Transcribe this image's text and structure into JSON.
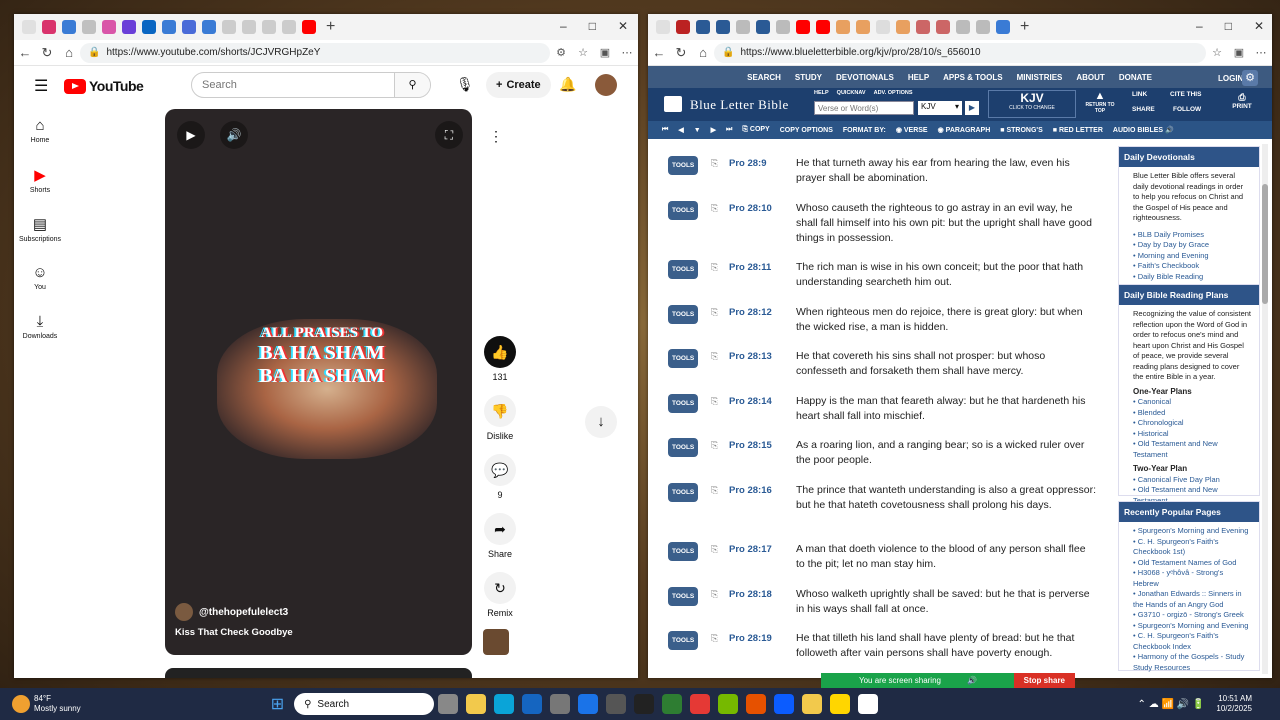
{
  "colors": {
    "yt_red": "#ff0000",
    "blb_nav": "#3d5a80",
    "blb_bar": "#1d3f6e",
    "blb_tool": "#2b5486",
    "blb_link": "#2a5a95"
  },
  "left": {
    "url": "https://www.youtube.com/shorts/JCJVRGHpZeY",
    "logo": "YouTube",
    "search_placeholder": "Search",
    "create_label": "Create",
    "sidebar": [
      {
        "label": "Home",
        "icon": "home-icon"
      },
      {
        "label": "Shorts",
        "icon": "shorts-icon"
      },
      {
        "label": "Subscriptions",
        "icon": "subscriptions-icon"
      },
      {
        "label": "You",
        "icon": "user-icon"
      },
      {
        "label": "Downloads",
        "icon": "download-icon"
      }
    ],
    "art_lines": [
      "ALL PRAISES TO",
      "BA HA SHAM",
      "BA HA SHAM"
    ],
    "channel": "@thehopefulelect3",
    "song": "Kiss That Check Goodbye",
    "likes": "131",
    "dislike": "Dislike",
    "comments": "9",
    "share": "Share",
    "remix": "Remix"
  },
  "right": {
    "url": "https://www.blueletterbible.org/kjv/pro/28/10/s_656010",
    "nav": [
      "SEARCH",
      "STUDY",
      "DEVOTIONALS",
      "HELP",
      "APPS & TOOLS",
      "MINISTRIES",
      "ABOUT",
      "DONATE"
    ],
    "login": "LOGIN",
    "brand": "Blue Letter Bible",
    "sublinks": [
      "HELP",
      "QUICKNAV",
      "ADV. OPTIONS"
    ],
    "search_placeholder": "Verse or Word(s)",
    "version": "KJV",
    "version_big": "KJV",
    "version_sub": "CLICK TO CHANGE",
    "return_top": "RETURN TO TOP",
    "link": "LINK",
    "cite": "CITE THIS",
    "share": "SHARE",
    "follow": "FOLLOW",
    "print": "PRINT",
    "toolbar": [
      "COPY",
      "COPY OPTIONS",
      "FORMAT BY:",
      "VERSE",
      "PARAGRAPH",
      "STRONG'S",
      "RED LETTER",
      "AUDIO BIBLES"
    ],
    "tools_label": "TOOLS",
    "verses": [
      {
        "ref": "Pro 28:9",
        "text": "He that turneth away his ear from hearing the law, even his prayer shall be abomination."
      },
      {
        "ref": "Pro 28:10",
        "text": "Whoso causeth the righteous to go astray in an evil way, he shall fall himself into his own pit: but the upright shall have good things in possession."
      },
      {
        "ref": "Pro 28:11",
        "text": "The rich man is wise in his own conceit; but the poor that hath understanding searcheth him out."
      },
      {
        "ref": "Pro 28:12",
        "text": "When righteous men do rejoice, there is great glory: but when the wicked rise, a man is hidden."
      },
      {
        "ref": "Pro 28:13",
        "text": "He that covereth his sins shall not prosper: but whoso confesseth and forsaketh them shall have mercy."
      },
      {
        "ref": "Pro 28:14",
        "text": "Happy is the man that feareth alway: but he that hardeneth his heart shall fall into mischief."
      },
      {
        "ref": "Pro 28:15",
        "text": "As a roaring lion, and a ranging bear; so is a wicked ruler over the poor people."
      },
      {
        "ref": "Pro 28:16",
        "text": "The prince that wanteth understanding is also a great oppressor: but he that hateth covetousness shall prolong his days."
      },
      {
        "ref": "Pro 28:17",
        "text": "A man that doeth violence to the blood of any person shall flee to the pit; let no man stay him."
      },
      {
        "ref": "Pro 28:18",
        "text": "Whoso walketh uprightly shall be saved: but he that is perverse in his ways shall fall at once."
      },
      {
        "ref": "Pro 28:19",
        "text": "He that tilleth his land shall have plenty of bread: but he that followeth after vain persons shall have poverty enough."
      }
    ],
    "dev": {
      "title": "Daily Devotionals",
      "intro": "Blue Letter Bible offers several daily devotional readings in order to help you refocus on Christ and the Gospel of His peace and righteousness.",
      "links": [
        "BLB Daily Promises",
        "Day by Day by Grace",
        "Morning and Evening",
        "Faith's Checkbook",
        "Daily Bible Reading"
      ]
    },
    "plans": {
      "title": "Daily Bible Reading Plans",
      "intro": "Recognizing the value of consistent reflection upon the Word of God in order to refocus one's mind and heart upon Christ and His Gospel of peace, we provide several reading plans designed to cover the entire Bible in a year.",
      "one_year": "One-Year Plans",
      "one_links": [
        "Canonical",
        "Blended",
        "Chronological",
        "Historical",
        "Old Testament and New Testament"
      ],
      "two_year": "Two-Year Plan",
      "two_links": [
        "Canonical Five Day Plan",
        "Old Testament and New Testament"
      ]
    },
    "popular": {
      "title": "Recently Popular Pages",
      "links": [
        "Spurgeon's Morning and Evening",
        "C. H. Spurgeon's Faith's Checkbook 1st)",
        "Old Testament Names of God",
        "H3068 - yᵉhôvâ - Strong's Hebrew",
        "Jonathan Edwards :: Sinners in the Hands of an Angry God",
        "G3710 - orgizō - Strong's Greek",
        "Spurgeon's Morning and Evening",
        "C. H. Spurgeon's Faith's Checkbook Index",
        "Harmony of the Gospels - Study Study Resources"
      ]
    }
  },
  "screenshare": {
    "msg": "You are screen sharing",
    "stop": "Stop share"
  },
  "taskbar": {
    "weather_temp": "84°F",
    "weather_desc": "Mostly sunny",
    "search": "Search",
    "time": "10:51 AM",
    "date": "10/2/2025"
  }
}
